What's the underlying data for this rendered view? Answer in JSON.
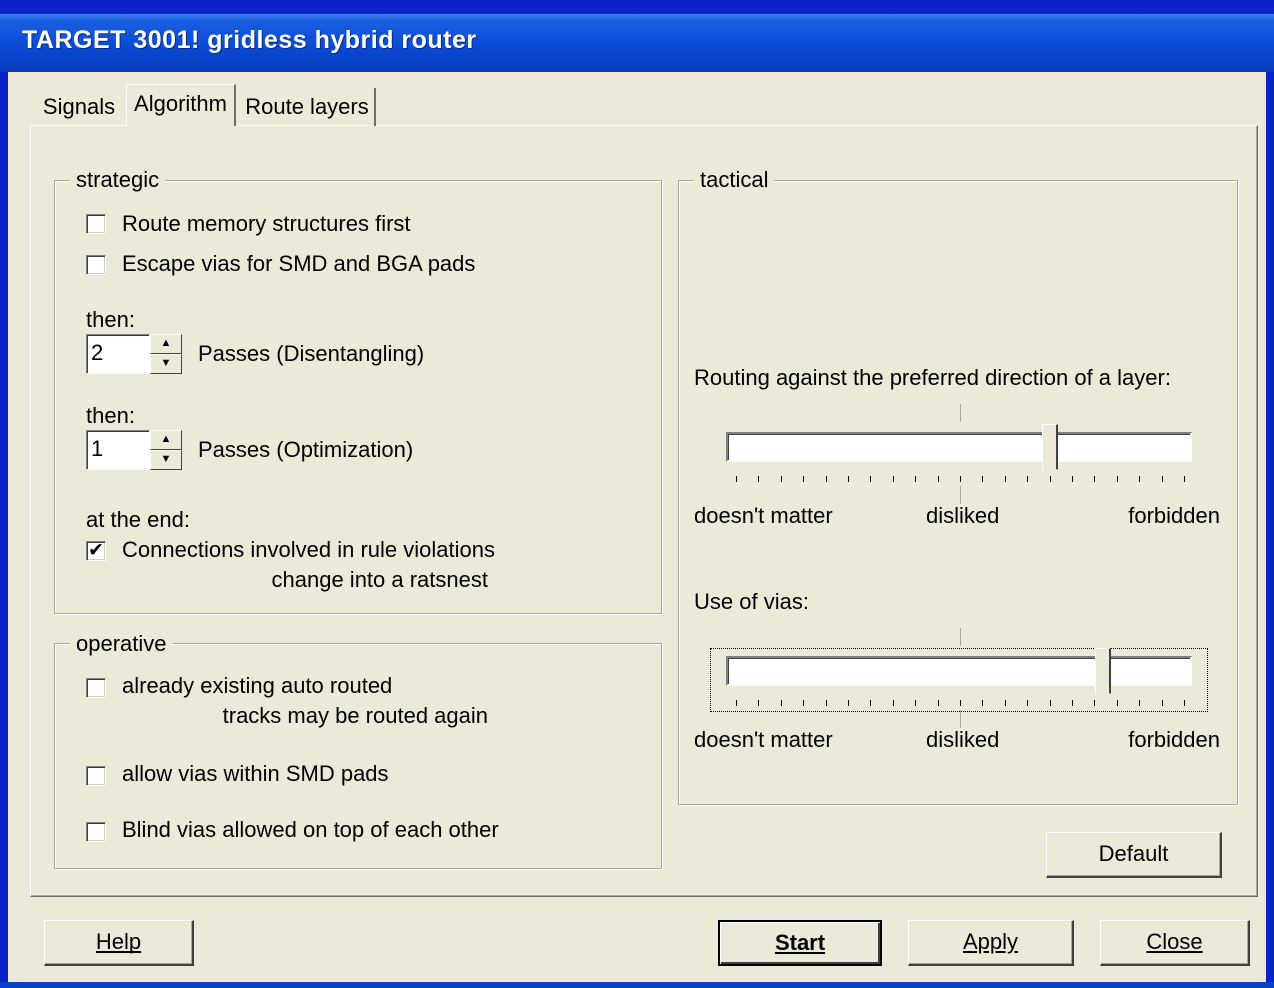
{
  "window": {
    "title": "TARGET 3001! gridless hybrid router"
  },
  "tabs": [
    {
      "label": "Signals",
      "active": false
    },
    {
      "label": "Algorithm",
      "active": true
    },
    {
      "label": "Route layers",
      "active": false
    }
  ],
  "strategic": {
    "title": "strategic",
    "route_memory_first": {
      "label": "Route memory structures first",
      "checked": false
    },
    "escape_vias": {
      "label": "Escape vias for SMD and BGA pads",
      "checked": false
    },
    "then_label_1": "then:",
    "passes_disentangling": {
      "value": "2",
      "label": "Passes (Disentangling)"
    },
    "then_label_2": "then:",
    "passes_optimization": {
      "value": "1",
      "label": "Passes (Optimization)"
    },
    "at_end_label": "at the end:",
    "ratsnest": {
      "label_line1": "Connections involved in rule  violations",
      "label_line2": "change into a ratsnest",
      "checked": true
    }
  },
  "operative": {
    "title": "operative",
    "reroute": {
      "label_line1": "already existing auto routed",
      "label_line2": "tracks may be routed again",
      "checked": false
    },
    "vias_in_smd": {
      "label": "allow vias within SMD pads",
      "checked": false
    },
    "blind_vias": {
      "label": "Blind vias allowed on top of each other",
      "checked": false
    }
  },
  "tactical": {
    "title": "tactical",
    "preferred_direction": {
      "label": "Routing against the preferred direction of a layer:",
      "level": 0.7,
      "scale": {
        "min": "doesn't matter",
        "mid": "disliked",
        "max": "forbidden"
      }
    },
    "vias_usage": {
      "label": "Use of vias:",
      "level": 0.82,
      "scale": {
        "min": "doesn't matter",
        "mid": "disliked",
        "max": "forbidden"
      }
    }
  },
  "buttons": {
    "default": "Default",
    "help": "Help",
    "start": "Start",
    "apply": "Apply",
    "close": "Close"
  },
  "colors": {
    "titlebar": "#0842c4",
    "dialog_bg": "#ece9d8"
  }
}
